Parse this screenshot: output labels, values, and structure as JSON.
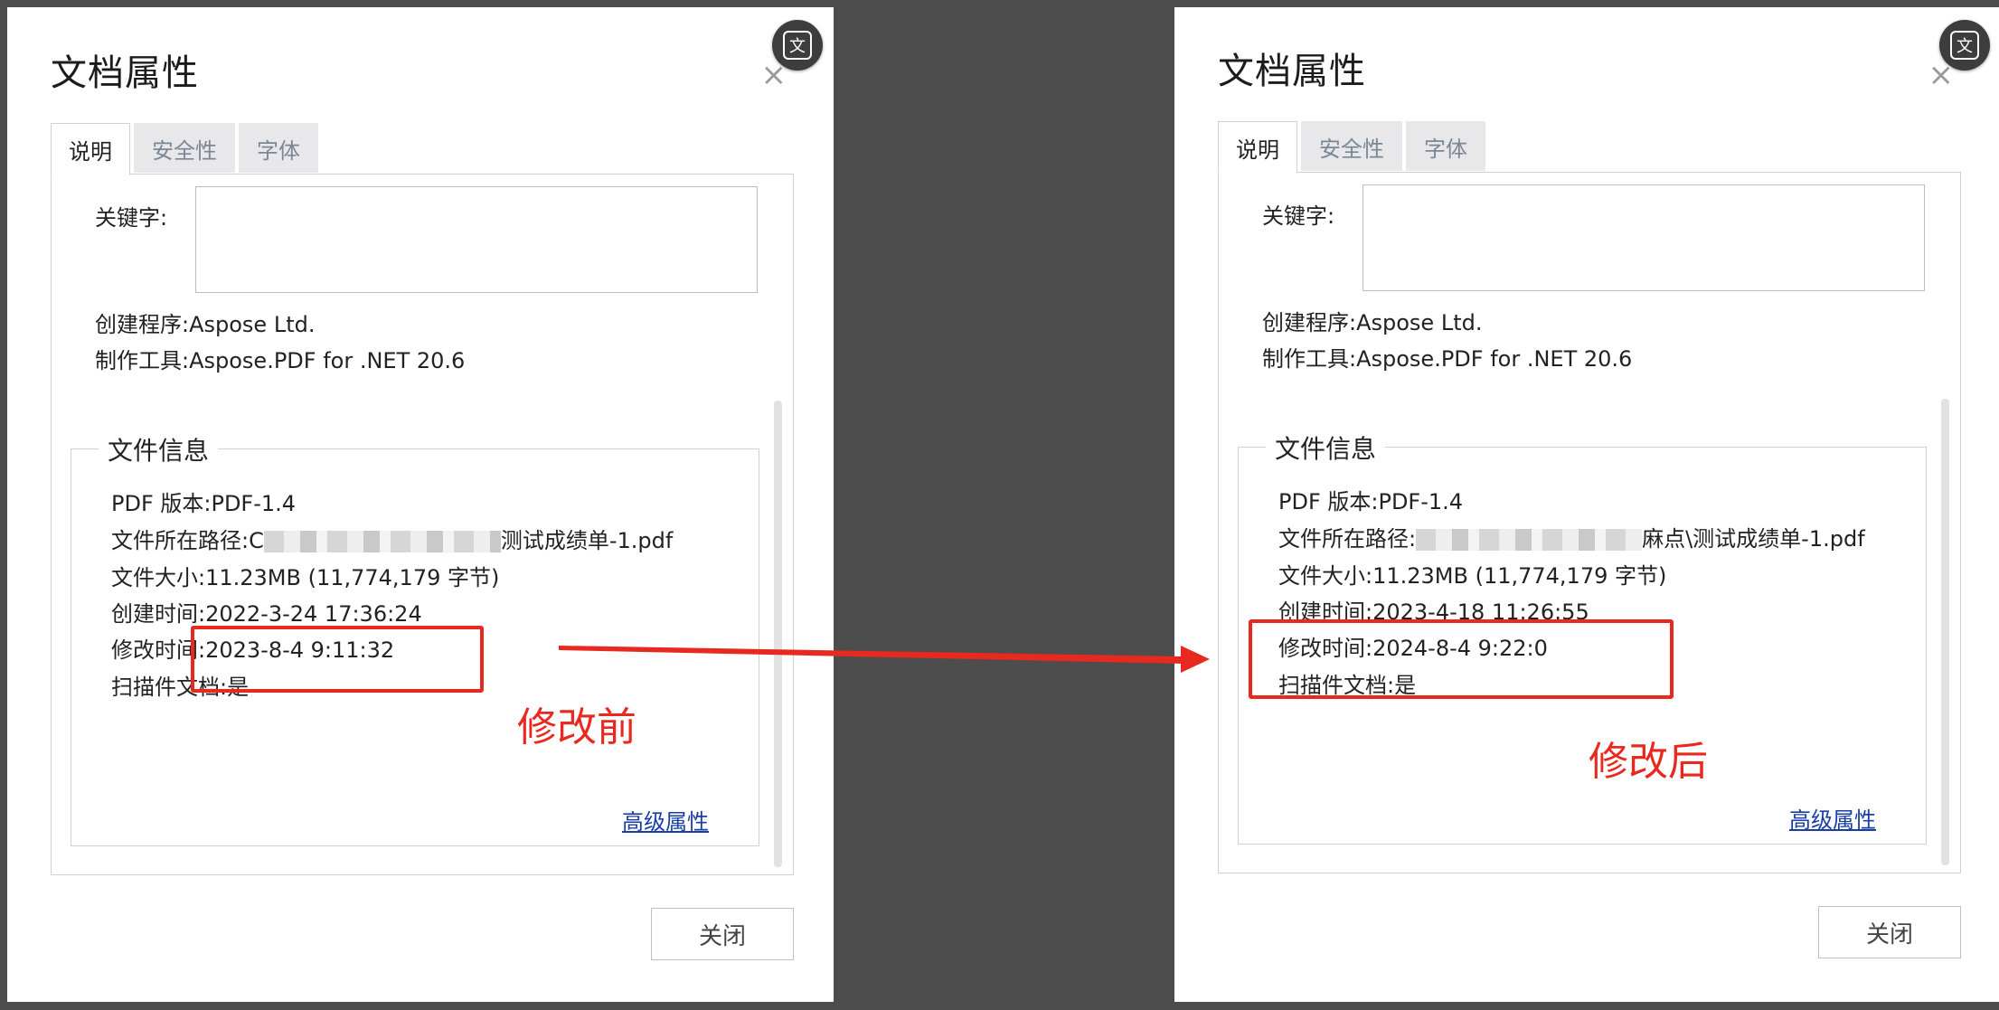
{
  "left": {
    "title": "文档属性",
    "close_x": "×",
    "tabs": [
      "说明",
      "安全性",
      "字体"
    ],
    "keywords_label": "关键字:",
    "creator": "创建程序:Aspose Ltd.",
    "producer": "制作工具:Aspose.PDF for .NET 20.6",
    "file_info_legend": "文件信息",
    "pdf_version": "PDF 版本:PDF-1.4",
    "path_prefix": "文件所在路径:C",
    "path_suffix": "测试成绩单-1.pdf",
    "file_size": "文件大小:11.23MB (11,774,179 字节)",
    "created": "创建时间:2022-3-24 17:36:24",
    "modified": "修改时间:2023-8-4 9:11:32",
    "scanned": "扫描件文档:是",
    "advanced_link": "高级属性",
    "close_button": "关闭",
    "annotation": "修改前"
  },
  "right": {
    "title": "文档属性",
    "close_x": "×",
    "tabs": [
      "说明",
      "安全性",
      "字体"
    ],
    "keywords_label": "关键字:",
    "creator": "创建程序:Aspose Ltd.",
    "producer": "制作工具:Aspose.PDF for .NET 20.6",
    "file_info_legend": "文件信息",
    "pdf_version": "PDF 版本:PDF-1.4",
    "path_prefix": "文件所在路径:",
    "path_suffix": "麻点\\测试成绩单-1.pdf",
    "file_size": "文件大小:11.23MB (11,774,179 字节)",
    "created": "创建时间:2023-4-18 11:26:55",
    "modified": "修改时间:2024-8-4 9:22:0",
    "scanned": "扫描件文档:是",
    "advanced_link": "高级属性",
    "close_button": "关闭",
    "annotation": "修改后"
  },
  "translate_glyph": "文",
  "colors": {
    "annotation_red": "#e8291f",
    "backdrop": "#4d4d4d",
    "link_blue": "#1a3ea8"
  }
}
